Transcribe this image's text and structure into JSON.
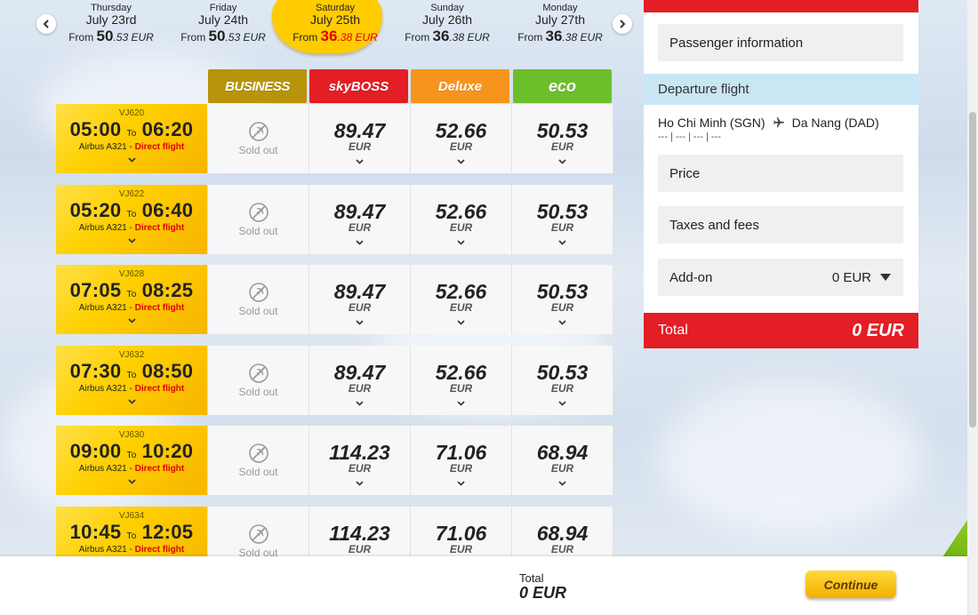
{
  "dates": [
    {
      "dow": "Thursday",
      "date": "July 23rd",
      "from": "From",
      "price_main": "50",
      "price_dec": ".53 EUR",
      "active": false
    },
    {
      "dow": "Friday",
      "date": "July 24th",
      "from": "From",
      "price_main": "50",
      "price_dec": ".53 EUR",
      "active": false
    },
    {
      "dow": "Saturday",
      "date": "July 25th",
      "from": "From",
      "price_main": "36",
      "price_dec": ".38 EUR",
      "active": true
    },
    {
      "dow": "Sunday",
      "date": "July 26th",
      "from": "From",
      "price_main": "36",
      "price_dec": ".38 EUR",
      "active": false
    },
    {
      "dow": "Monday",
      "date": "July 27th",
      "from": "From",
      "price_main": "36",
      "price_dec": ".38 EUR",
      "active": false
    }
  ],
  "fare_classes": [
    {
      "label": "BUSINESS",
      "color": "#b8940a"
    },
    {
      "label": "skyBOSS",
      "color": "#e31e24"
    },
    {
      "label": "Deluxe",
      "color": "#f7941d"
    },
    {
      "label": "eco",
      "color": "#6cbf2a"
    }
  ],
  "flights": [
    {
      "code": "VJ620",
      "depart": "05:00",
      "to": "To",
      "arrive": "06:20",
      "aircraft": "Airbus A321 -",
      "direct": "Direct flight",
      "business": "Sold out",
      "skyboss": "89.47",
      "deluxe": "52.66",
      "eco": "50.53",
      "currency": "EUR"
    },
    {
      "code": "VJ622",
      "depart": "05:20",
      "to": "To",
      "arrive": "06:40",
      "aircraft": "Airbus A321 -",
      "direct": "Direct flight",
      "business": "Sold out",
      "skyboss": "89.47",
      "deluxe": "52.66",
      "eco": "50.53",
      "currency": "EUR"
    },
    {
      "code": "VJ628",
      "depart": "07:05",
      "to": "To",
      "arrive": "08:25",
      "aircraft": "Airbus A321 -",
      "direct": "Direct flight",
      "business": "Sold out",
      "skyboss": "89.47",
      "deluxe": "52.66",
      "eco": "50.53",
      "currency": "EUR"
    },
    {
      "code": "VJ632",
      "depart": "07:30",
      "to": "To",
      "arrive": "08:50",
      "aircraft": "Airbus A321 -",
      "direct": "Direct flight",
      "business": "Sold out",
      "skyboss": "89.47",
      "deluxe": "52.66",
      "eco": "50.53",
      "currency": "EUR"
    },
    {
      "code": "VJ630",
      "depart": "09:00",
      "to": "To",
      "arrive": "10:20",
      "aircraft": "Airbus A321 -",
      "direct": "Direct flight",
      "business": "Sold out",
      "skyboss": "114.23",
      "deluxe": "71.06",
      "eco": "68.94",
      "currency": "EUR"
    },
    {
      "code": "VJ634",
      "depart": "10:45",
      "to": "To",
      "arrive": "12:05",
      "aircraft": "Airbus A321 -",
      "direct": "Direct flight",
      "business": "Sold out",
      "skyboss": "114.23",
      "deluxe": "71.06",
      "eco": "68.94",
      "currency": "EUR"
    }
  ],
  "panel": {
    "passenger_info": "Passenger information",
    "departure_flight": "Departure flight",
    "origin": "Ho Chi Minh (SGN)",
    "destination": "Da Nang (DAD)",
    "route_sub": "--- | --- | --- | ---",
    "price_label": "Price",
    "taxes_label": "Taxes and fees",
    "addon_label": "Add-on",
    "addon_value": "0 EUR",
    "total_label": "Total",
    "total_value": "0 EUR"
  },
  "bottom": {
    "total_label": "Total",
    "total_value": "0 EUR",
    "continue_label": "Continue"
  },
  "colors": {
    "accent_red": "#e31e24",
    "accent_yellow": "#ffd000",
    "panel_header_blue": "#c9e6f5"
  },
  "icons": {
    "prev": "chevron-left-icon",
    "next": "chevron-right-icon",
    "plane": "plane-icon",
    "sold_out": "plane-blocked-icon",
    "expand": "chevron-down-icon",
    "dropdown": "caret-down-icon"
  }
}
